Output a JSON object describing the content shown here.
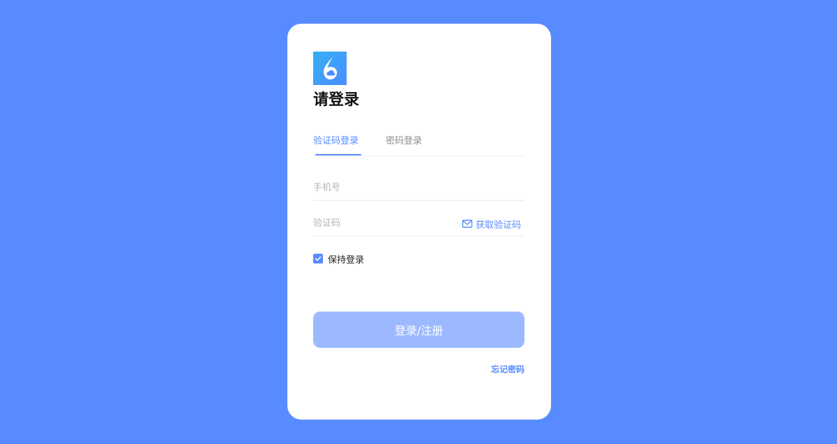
{
  "login": {
    "title": "请登录",
    "logo_icon": "droplet-cloud-logo",
    "tabs": [
      {
        "label": "验证码登录",
        "active": true
      },
      {
        "label": "密码登录",
        "active": false
      }
    ],
    "phone": {
      "placeholder": "手机号",
      "value": ""
    },
    "code": {
      "placeholder": "验证码",
      "value": "",
      "get_code_label": "获取验证码",
      "icon": "mail-icon"
    },
    "remember": {
      "label": "保持登录",
      "checked": true,
      "icon": "checkmark-icon"
    },
    "submit_label": "登录/注册",
    "forgot_label": "忘记密码"
  },
  "colors": {
    "background": "#588bff",
    "accent": "#588bff",
    "button_disabled": "#9cb9ff"
  }
}
